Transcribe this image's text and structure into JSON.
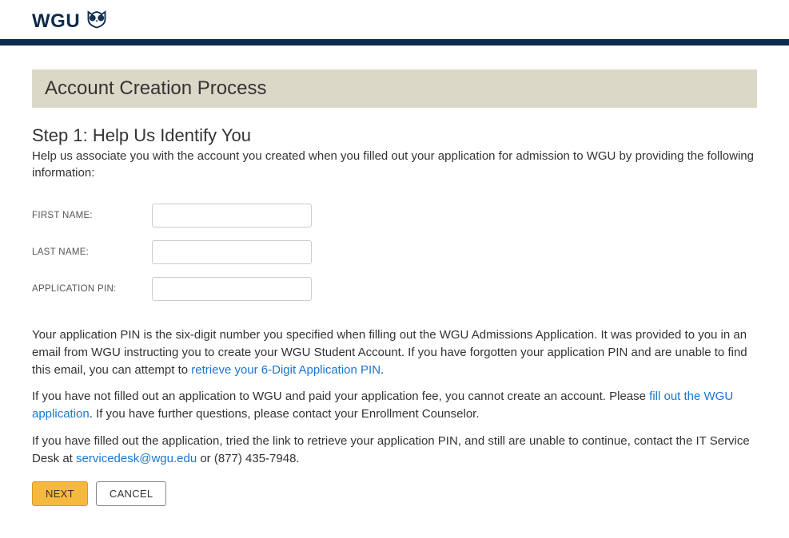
{
  "logo": {
    "text": "WGU"
  },
  "banner": {
    "title": "Account Creation Process"
  },
  "step": {
    "title": "Step 1: Help Us Identify You",
    "description": "Help us associate you with the account you created when you filled out your application for admission to WGU by providing the following information:"
  },
  "form": {
    "first_name_label": "FIRST NAME:",
    "first_name_value": "",
    "last_name_label": "LAST NAME:",
    "last_name_value": "",
    "pin_label": "APPLICATION PIN:",
    "pin_value": ""
  },
  "info": {
    "p1_a": "Your application PIN is the six-digit number you specified when filling out the WGU Admissions Application. It was provided to you in an email from WGU instructing you to create your WGU Student Account. If you have forgotten your application PIN and are unable to find this email, you can attempt to ",
    "p1_link": "retrieve your 6-Digit Application PIN",
    "p1_b": ".",
    "p2_a": "If you have not filled out an application to WGU and paid your application fee, you cannot create an account. Please ",
    "p2_link": "fill out the WGU application",
    "p2_b": ". If you have further questions, please contact your Enrollment Counselor.",
    "p3_a": "If you have filled out the application, tried the link to retrieve your application PIN, and still are unable to continue, contact the IT Service Desk at ",
    "p3_link": "servicedesk@wgu.edu",
    "p3_b": " or (877) 435-7948."
  },
  "buttons": {
    "next": "NEXT",
    "cancel": "CANCEL"
  }
}
